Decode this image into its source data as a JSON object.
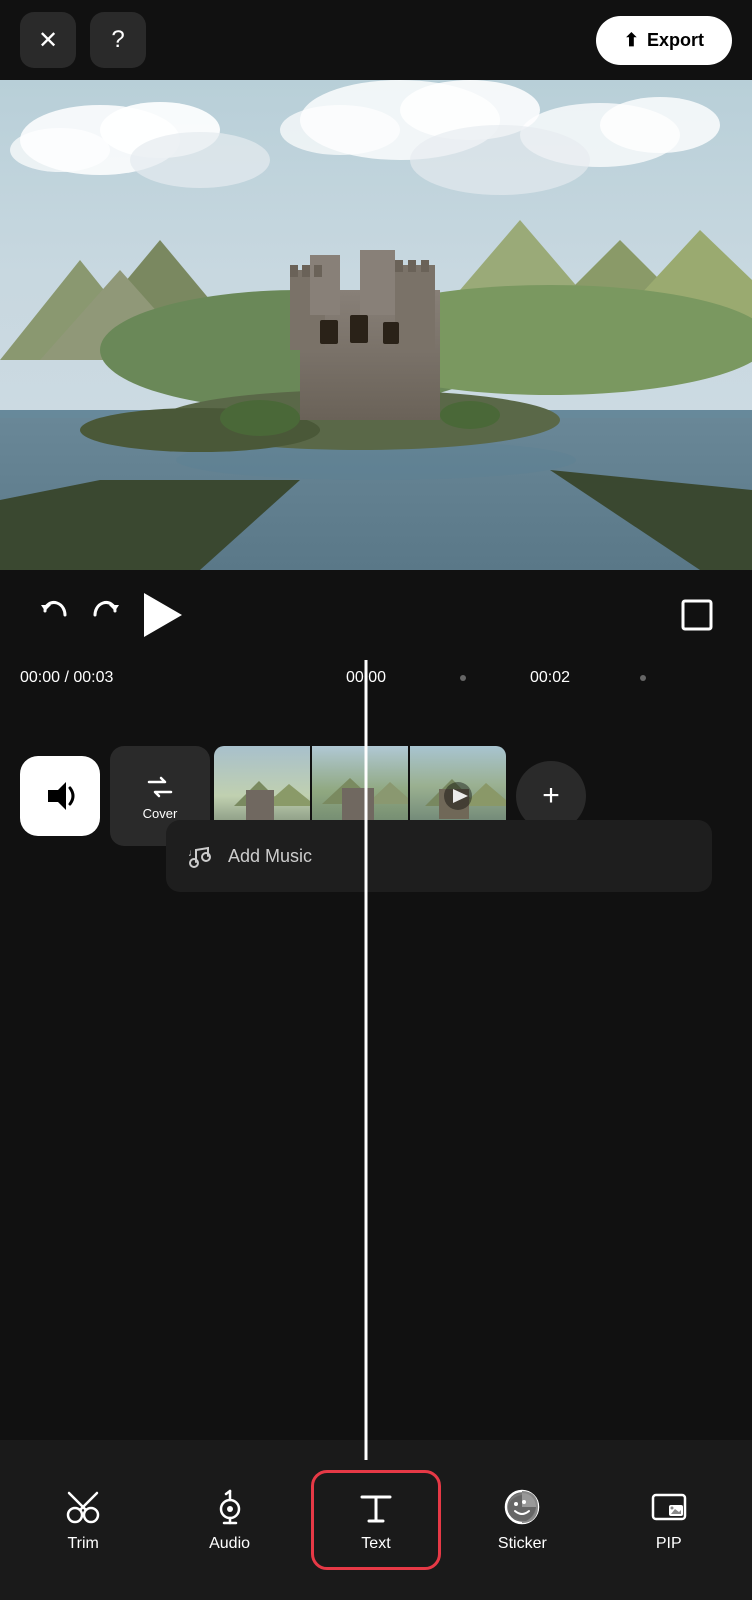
{
  "topBar": {
    "closeLabel": "✕",
    "helpLabel": "?",
    "exportLabel": "Export",
    "uploadIcon": "⬆"
  },
  "controls": {
    "undoIcon": "↩",
    "redoIcon": "↪",
    "playIcon": "▶",
    "fullscreenIcon": "⛶",
    "timeDisplay": "00:00 / 00:03",
    "marker1": "00:00",
    "marker2": "00:02"
  },
  "timeline": {
    "volumeIcon": "🔊",
    "coverLabel": "Cover",
    "addMusicLabel": "Add Music",
    "addIcon": "+"
  },
  "toolbar": {
    "items": [
      {
        "id": "trim",
        "label": "Trim",
        "icon": "trim"
      },
      {
        "id": "audio",
        "label": "Audio",
        "icon": "audio"
      },
      {
        "id": "text",
        "label": "Text",
        "icon": "text",
        "active": true
      },
      {
        "id": "sticker",
        "label": "Sticker",
        "icon": "sticker"
      },
      {
        "id": "pip",
        "label": "PIP",
        "icon": "pip"
      }
    ]
  }
}
